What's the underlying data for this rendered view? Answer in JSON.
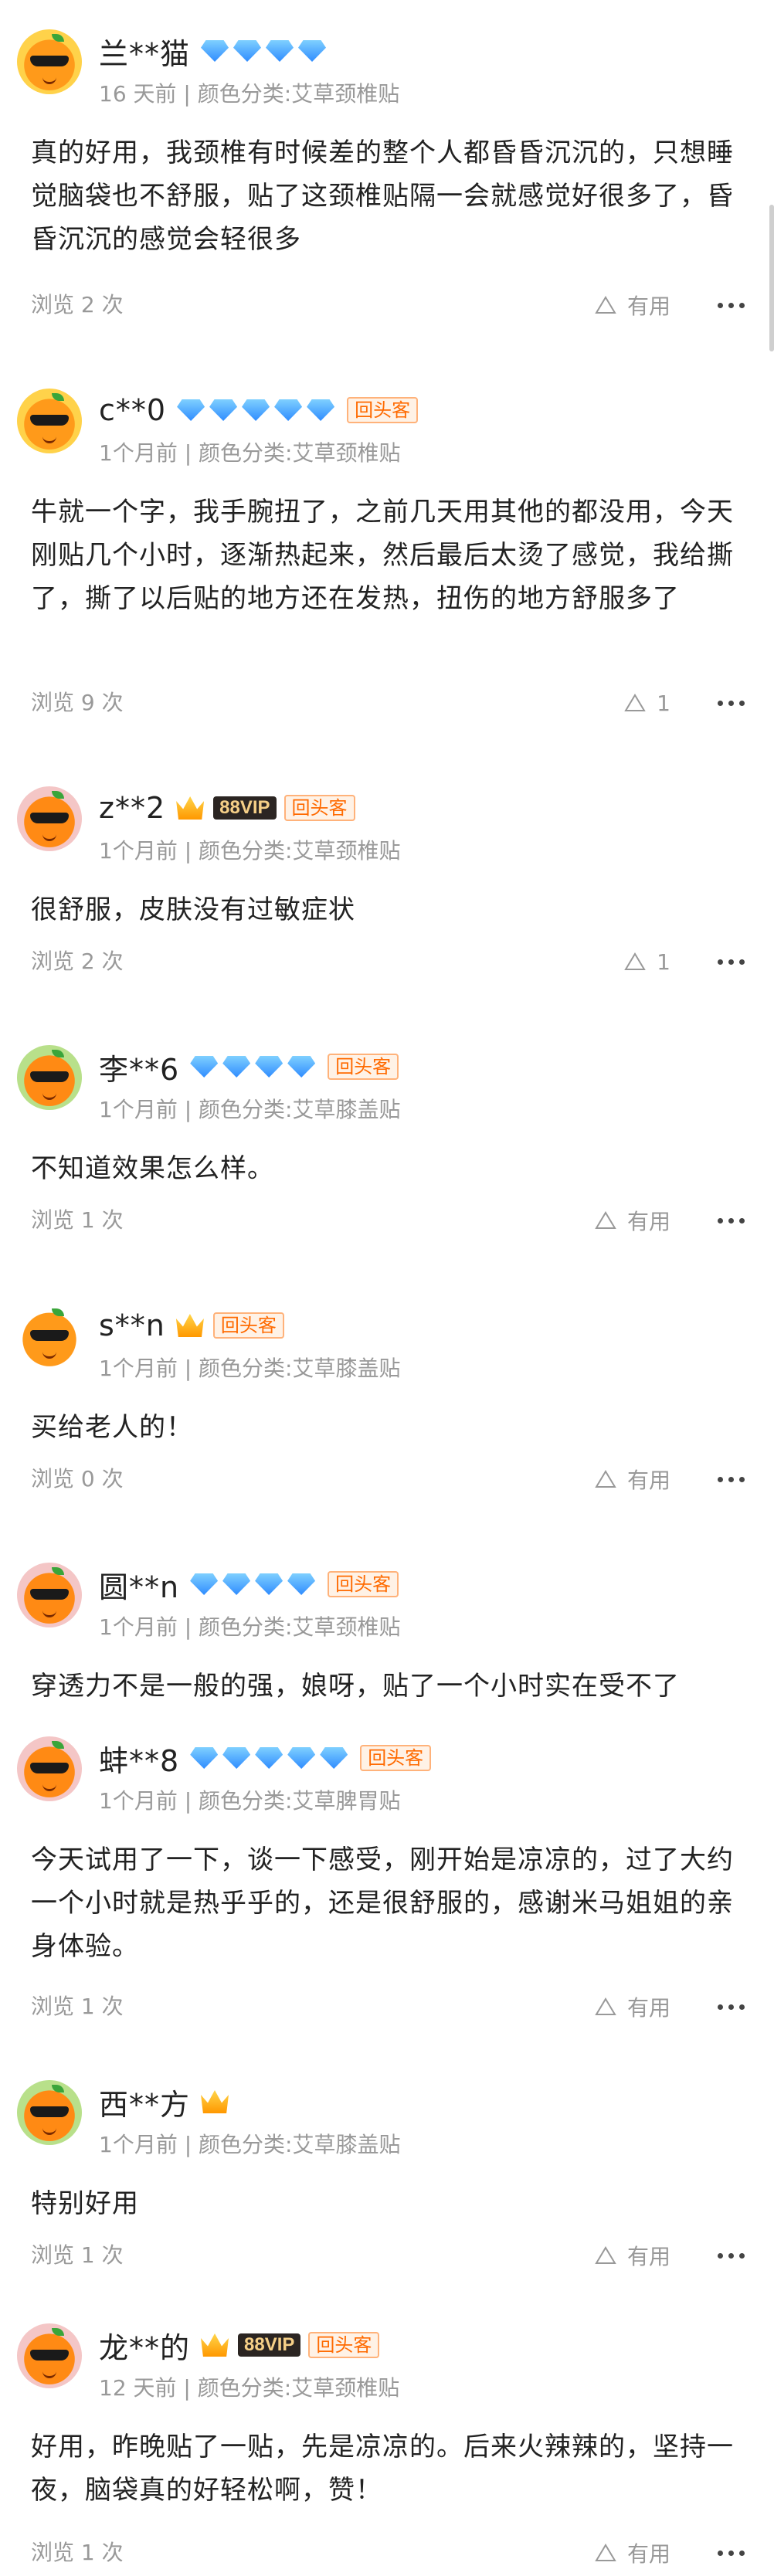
{
  "helpful_label": "有用",
  "reviews": [
    {
      "user": "兰**猫",
      "diamonds": 4,
      "crown": false,
      "vip": "",
      "return_tag": "",
      "meta": "16 天前 | 颜色分类:艾草颈椎贴",
      "content": "真的好用，我颈椎有时候差的整个人都昏昏沉沉的，只想睡觉脑袋也不舒服，贴了这颈椎贴隔一会就感觉好很多了，昏昏沉沉的感觉会轻很多",
      "views": "浏览 2 次",
      "helpful": "有用"
    },
    {
      "user": "c**0",
      "diamonds": 5,
      "crown": false,
      "vip": "",
      "return_tag": "回头客",
      "meta": "1个月前 | 颜色分类:艾草颈椎贴",
      "content": "牛就一个字，我手腕扭了，之前几天用其他的都没用，今天刚贴几个小时，逐渐热起来，然后最后太烫了感觉，我给撕了，撕了以后贴的地方还在发热，扭伤的地方舒服多了",
      "views": "浏览 9 次",
      "helpful": "1"
    },
    {
      "user": "z**2",
      "diamonds": 0,
      "crown": true,
      "vip": "88VIP",
      "return_tag": "回头客",
      "meta": "1个月前 | 颜色分类:艾草颈椎贴",
      "content": "很舒服，皮肤没有过敏症状",
      "views": "浏览 2 次",
      "helpful": "1"
    },
    {
      "user": "李**6",
      "diamonds": 4,
      "crown": false,
      "vip": "",
      "return_tag": "回头客",
      "meta": "1个月前 | 颜色分类:艾草膝盖贴",
      "content": "不知道效果怎么样。",
      "views": "浏览 1 次",
      "helpful": "有用"
    },
    {
      "user": "s**n",
      "diamonds": 0,
      "crown": true,
      "vip": "",
      "return_tag": "回头客",
      "meta": "1个月前 | 颜色分类:艾草膝盖贴",
      "content": "买给老人的！",
      "views": "浏览 0 次",
      "helpful": "有用"
    },
    {
      "user": "圆**n",
      "diamonds": 4,
      "crown": false,
      "vip": "",
      "return_tag": "回头客",
      "meta": "1个月前 | 颜色分类:艾草颈椎贴",
      "content": "穿透力不是一般的强，娘呀，贴了一个小时实在受不了",
      "views": "",
      "helpful": ""
    },
    {
      "user": "蚌**8",
      "diamonds": 5,
      "crown": false,
      "vip": "",
      "return_tag": "回头客",
      "meta": "1个月前 | 颜色分类:艾草脾胃贴",
      "content": "今天试用了一下，谈一下感受，刚开始是凉凉的，过了大约一个小时就是热乎乎的，还是很舒服的，感谢米马姐姐的亲身体验。",
      "views": "浏览 1 次",
      "helpful": "有用"
    },
    {
      "user": "西**方",
      "diamonds": 0,
      "crown": true,
      "vip": "",
      "return_tag": "",
      "meta": "1个月前 | 颜色分类:艾草膝盖贴",
      "content": "特别好用",
      "views": "浏览 1 次",
      "helpful": "有用"
    },
    {
      "user": "龙**的",
      "diamonds": 0,
      "crown": true,
      "vip": "88VIP",
      "return_tag": "回头客",
      "meta": "12 天前 | 颜色分类:艾草颈椎贴",
      "content": "好用，昨晚贴了一贴，先是凉凉的。后来火辣辣的，坚持一夜，脑袋真的好轻松啊，赞！",
      "views": "浏览 1 次",
      "helpful": "有用"
    }
  ]
}
